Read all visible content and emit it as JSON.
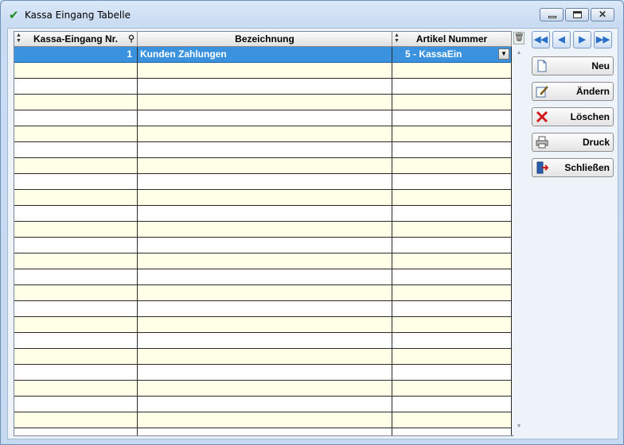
{
  "window": {
    "title": "Kassa Eingang Tabelle"
  },
  "grid": {
    "columns": [
      "Kassa-Eingang Nr.",
      "Bezeichnung",
      "Artikel Nummer"
    ],
    "rows": [
      {
        "nr": "1",
        "bezeichnung": "Kunden Zahlungen",
        "artikel": "5 - KassaEin"
      }
    ]
  },
  "actions": {
    "neu": "Neu",
    "aendern": "Ändern",
    "loeschen": "Löschen",
    "druck": "Druck",
    "schliessen": "Schließen"
  },
  "icons": {
    "title": "check-icon",
    "sort": "sort-arrows-icon",
    "key": "key-icon",
    "delete_column": "trash-icon",
    "neu": "new-document-icon",
    "aendern": "edit-icon",
    "loeschen": "delete-x-icon",
    "druck": "printer-icon",
    "schliessen": "exit-door-icon"
  },
  "colors": {
    "selected_row": "#3b93e0",
    "alt_row": "#fffee6"
  }
}
